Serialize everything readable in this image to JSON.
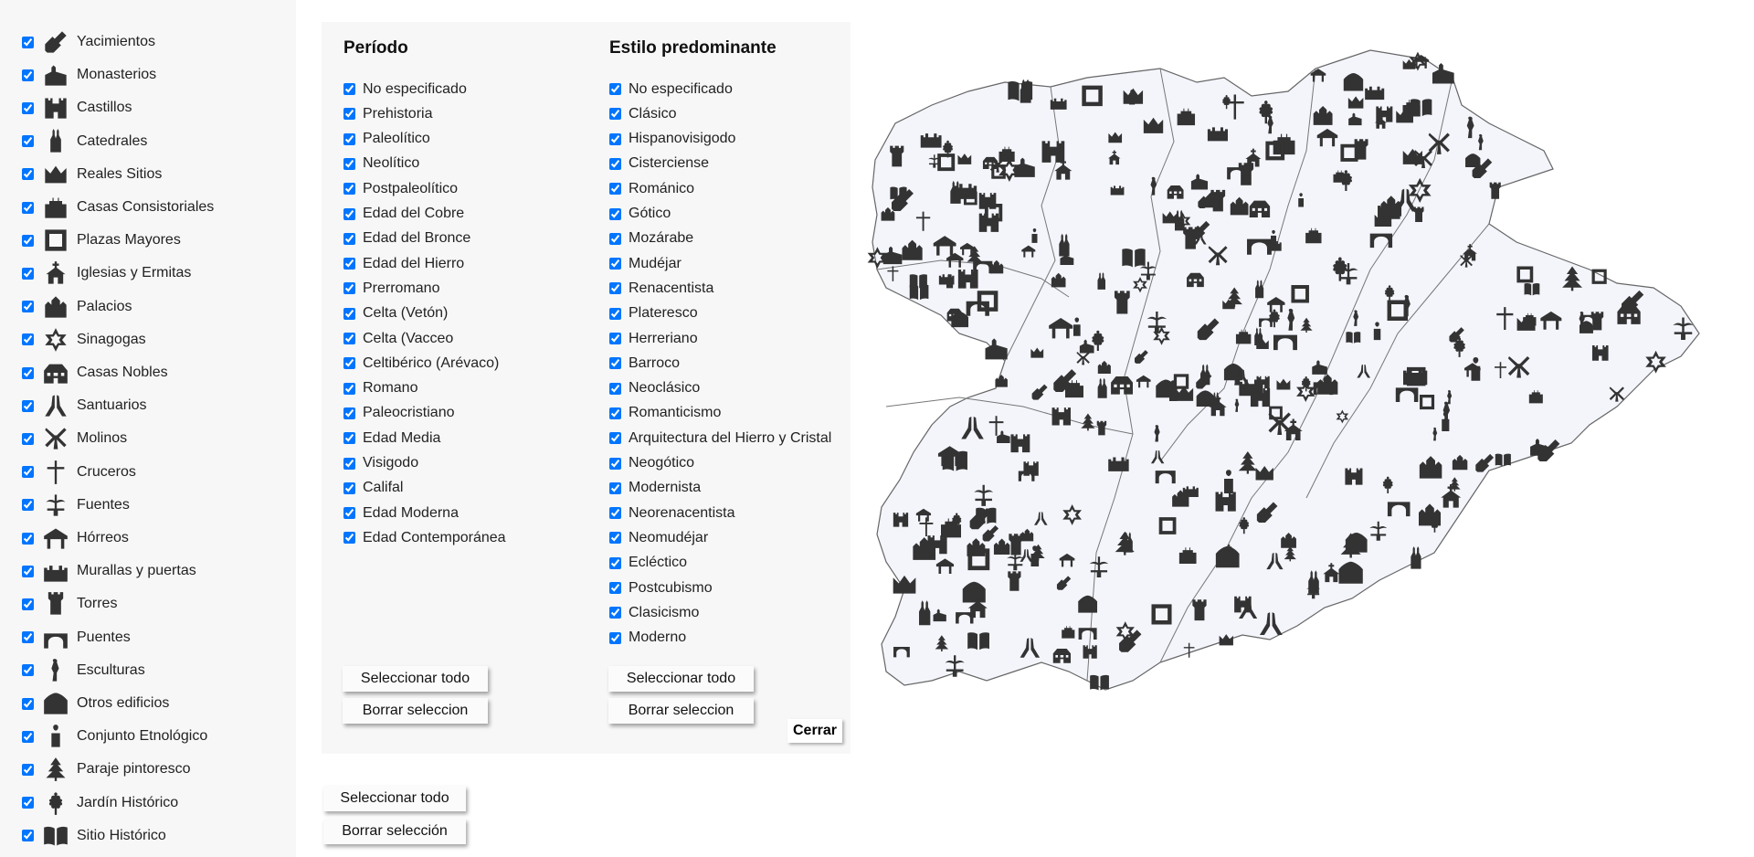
{
  "categories": [
    {
      "label": "Yacimientos",
      "icon": "shovel-icon",
      "checked": true
    },
    {
      "label": "Monasterios",
      "icon": "monastery-icon",
      "checked": true
    },
    {
      "label": "Castillos",
      "icon": "castle-icon",
      "checked": true
    },
    {
      "label": "Catedrales",
      "icon": "cathedral-icon",
      "checked": true
    },
    {
      "label": "Reales Sitios",
      "icon": "crown-icon",
      "checked": true
    },
    {
      "label": "Casas Consistoriales",
      "icon": "town-hall-icon",
      "checked": true
    },
    {
      "label": "Plazas Mayores",
      "icon": "square-icon",
      "checked": true
    },
    {
      "label": "Iglesias y Ermitas",
      "icon": "church-icon",
      "checked": true
    },
    {
      "label": "Palacios",
      "icon": "palace-icon",
      "checked": true
    },
    {
      "label": "Sinagogas",
      "icon": "star-of-david-icon",
      "checked": true
    },
    {
      "label": "Casas Nobles",
      "icon": "manor-house-icon",
      "checked": true
    },
    {
      "label": "Santuarios",
      "icon": "praying-hands-icon",
      "checked": true
    },
    {
      "label": "Molinos",
      "icon": "windmill-icon",
      "checked": true
    },
    {
      "label": "Cruceros",
      "icon": "cross-icon",
      "checked": true
    },
    {
      "label": "Fuentes",
      "icon": "fountain-icon",
      "checked": true
    },
    {
      "label": "Hórreos",
      "icon": "granary-icon",
      "checked": true
    },
    {
      "label": "Murallas y puertas",
      "icon": "wall-icon",
      "checked": true
    },
    {
      "label": "Torres",
      "icon": "tower-icon",
      "checked": true
    },
    {
      "label": "Puentes",
      "icon": "bridge-icon",
      "checked": true
    },
    {
      "label": "Esculturas",
      "icon": "statue-icon",
      "checked": true
    },
    {
      "label": "Otros edificios",
      "icon": "building-icon",
      "checked": true
    },
    {
      "label": "Conjunto Etnológico",
      "icon": "person-icon",
      "checked": true
    },
    {
      "label": "Paraje pintoresco",
      "icon": "tree-icon",
      "checked": true
    },
    {
      "label": "Jardín Histórico",
      "icon": "flower-icon",
      "checked": true
    },
    {
      "label": "Sitio Histórico",
      "icon": "book-icon",
      "checked": true
    }
  ],
  "periodo": {
    "title": "Período",
    "options": [
      "No especificado",
      "Prehistoria",
      "Paleolítico",
      "Neolítico",
      "Postpaleolítico",
      "Edad del Cobre",
      "Edad del Bronce",
      "Edad del Hierro",
      "Prerromano",
      "Celta (Vetón)",
      "Celta (Vacceo",
      "Celtibérico (Arévaco)",
      "Romano",
      "Paleocristiano",
      "Edad Media",
      "Visigodo",
      "Califal",
      "Edad Moderna",
      "Edad Contemporánea"
    ],
    "select_all": "Seleccionar todo",
    "clear": "Borrar seleccion"
  },
  "estilo": {
    "title": "Estilo predominante",
    "options": [
      "No especificado",
      "Clásico",
      "Hispanovisigodo",
      "Cisterciense",
      "Románico",
      "Gótico",
      "Mozárabe",
      "Mudéjar",
      "Renacentista",
      "Plateresco",
      "Herreriano",
      "Barroco",
      "Neoclásico",
      "Romanticismo",
      "Arquitectura del Hierro y Cristal",
      "Neogótico",
      "Modernista",
      "Neorenacentista",
      "Neomudéjar",
      "Ecléctico",
      "Postcubismo",
      "Clasicismo",
      "Moderno"
    ],
    "select_all": "Seleccionar todo",
    "clear": "Borrar seleccion"
  },
  "close_label": "Cerrar",
  "global": {
    "select_all": "Seleccionar todo",
    "clear": "Borrar selección"
  },
  "colors": {
    "sidebar_bg": "#f7f7f7",
    "panel_bg": "#f7f7f7",
    "icon_fill": "#333333",
    "map_fill": "#f3f5fb",
    "map_stroke": "#666666"
  }
}
